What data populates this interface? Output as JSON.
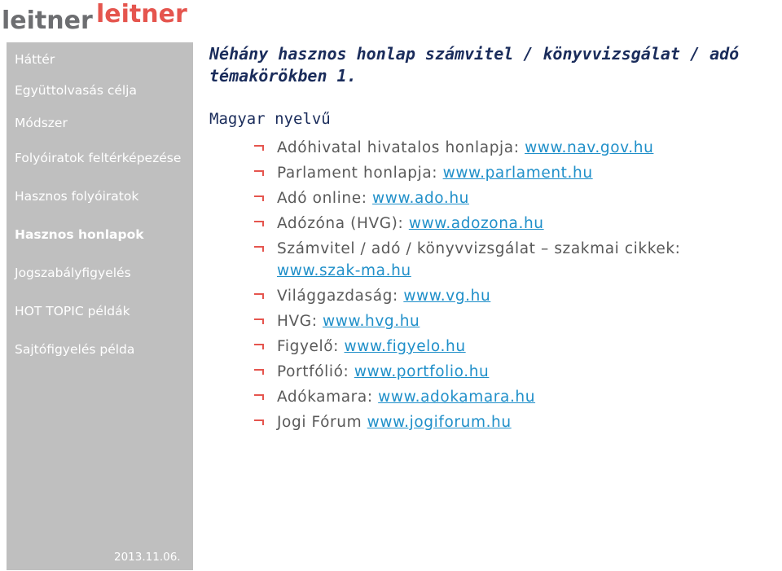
{
  "logo": {
    "part1": "leitner",
    "part2": "leitner"
  },
  "sidebar": {
    "items": [
      {
        "label": "Háttér",
        "active": false
      },
      {
        "label": "Együttolvasás célja",
        "active": false
      },
      {
        "label": "Módszer",
        "active": false
      },
      {
        "label": "Folyóiratok feltérképezése",
        "active": false
      },
      {
        "label": "Hasznos folyóiratok",
        "active": false
      },
      {
        "label": "Hasznos honlapok",
        "active": true
      },
      {
        "label": "Jogszabályfigyelés",
        "active": false
      },
      {
        "label": "HOT TOPIC példák",
        "active": false
      },
      {
        "label": "Sajtófigyelés példa",
        "active": false
      }
    ],
    "date": "2013.11.06."
  },
  "main": {
    "title": "Néhány hasznos honlap számvitel / könyvvizsgálat / adó témakörökben 1.",
    "subhead": "Magyar nyelvű",
    "links": [
      {
        "text": "Adóhivatal hivatalos honlapja: ",
        "url": "www.nav.gov.hu"
      },
      {
        "text": "Parlament honlapja: ",
        "url": "www.parlament.hu"
      },
      {
        "text": "Adó online: ",
        "url": "www.ado.hu"
      },
      {
        "text": "Adózóna (HVG): ",
        "url": "www.adozona.hu"
      },
      {
        "text": "Számvitel / adó / könyvvizsgálat – szakmai cikkek: ",
        "url": "www.szak-ma.hu"
      },
      {
        "text": "Világgazdaság: ",
        "url": "www.vg.hu"
      },
      {
        "text": "HVG: ",
        "url": "www.hvg.hu"
      },
      {
        "text": "Figyelő: ",
        "url": "www.figyelo.hu"
      },
      {
        "text": "Portfólió: ",
        "url": "www.portfolio.hu"
      },
      {
        "text": "Adókamara: ",
        "url": "www.adokamara.hu"
      },
      {
        "text": "Jogi Fórum ",
        "url": "www.jogiforum.hu"
      }
    ]
  },
  "colors": {
    "sidebar_bg": "#bfbfbf",
    "accent_red": "#e5554e",
    "title_navy": "#1a2c5b",
    "link_blue": "#1f8fc9",
    "body_gray": "#595959"
  }
}
